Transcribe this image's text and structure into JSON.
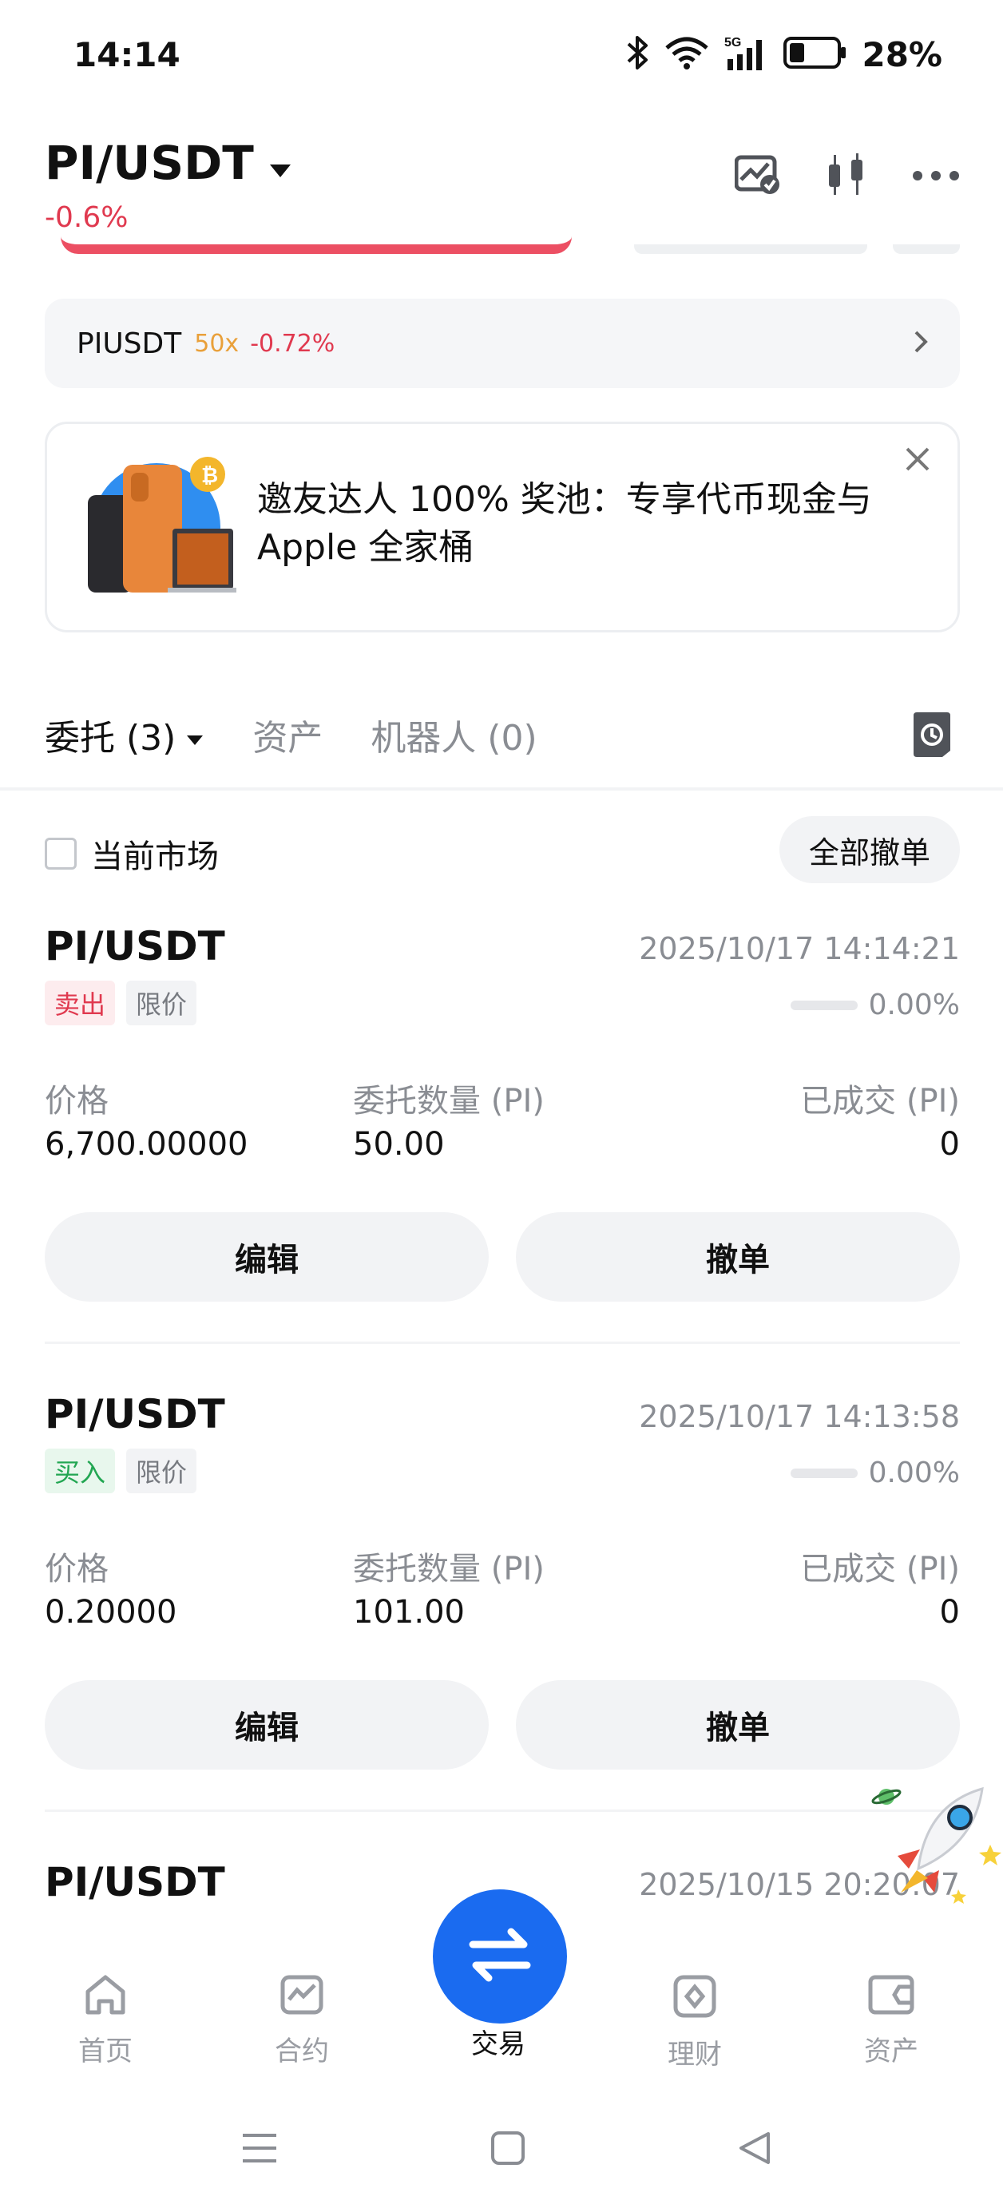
{
  "status": {
    "time": "14:14",
    "battery": "28%"
  },
  "header": {
    "pair": "PI/USDT",
    "change": "-0.6%"
  },
  "futures": {
    "name": "PIUSDT",
    "leverage": "50x",
    "change": "-0.72%"
  },
  "banner": {
    "text": "邀友达人 100% 奖池：专享代币现金与 Apple 全家桶"
  },
  "tabs": [
    {
      "label": "委托 (3)"
    },
    {
      "label": "资产"
    },
    {
      "label": "机器人 (0)"
    }
  ],
  "filter": {
    "current_market": "当前市场",
    "cancel_all": "全部撤单"
  },
  "columns": {
    "price": "价格",
    "amount": "委托数量 (PI)",
    "filled": "已成交 (PI)"
  },
  "actions": {
    "edit": "编辑",
    "cancel": "撤单"
  },
  "orders": [
    {
      "pair": "PI/USDT",
      "time": "2025/10/17 14:14:21",
      "side": "卖出",
      "type": "限价",
      "progress": "0.00%",
      "price": "6,700.00000",
      "amount": "50.00",
      "filled": "0"
    },
    {
      "pair": "PI/USDT",
      "time": "2025/10/17 14:13:58",
      "side": "买入",
      "type": "限价",
      "progress": "0.00%",
      "price": "0.20000",
      "amount": "101.00",
      "filled": "0"
    },
    {
      "pair": "PI/USDT",
      "time": "2025/10/15 20:20:07"
    }
  ],
  "nav": [
    {
      "label": "首页",
      "icon": "home-icon"
    },
    {
      "label": "合约",
      "icon": "futures-chart-icon"
    },
    {
      "label": "交易",
      "icon": "swap-arrows-icon"
    },
    {
      "label": "理财",
      "icon": "earn-icon"
    },
    {
      "label": "资产",
      "icon": "wallet-icon"
    }
  ],
  "colors": {
    "accent": "#1a6bf0",
    "down": "#e0394f",
    "up": "#22a652",
    "leverage": "#e9a03a"
  }
}
